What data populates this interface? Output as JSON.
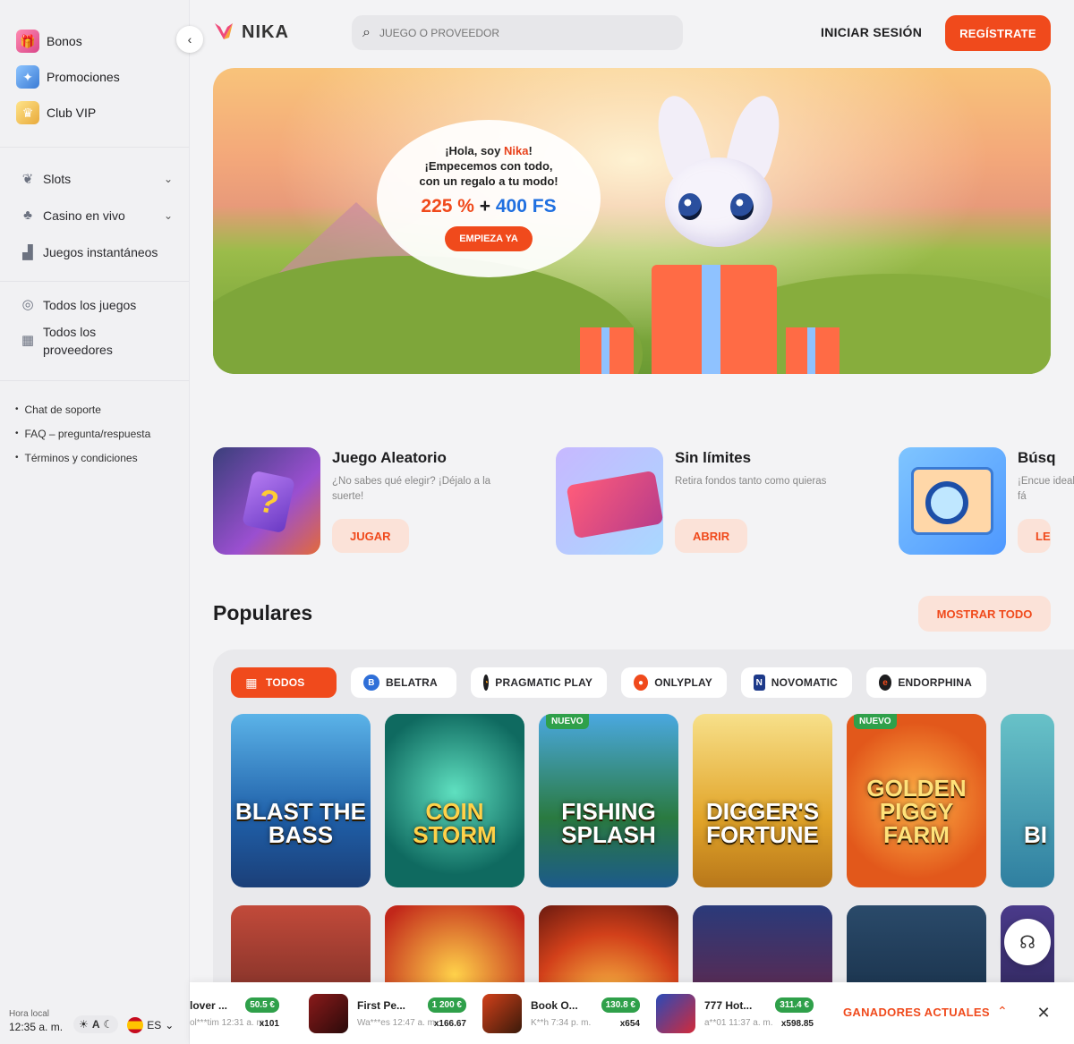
{
  "sidebar": {
    "top_items": [
      {
        "label": "Bonos",
        "icon": "gift-icon"
      },
      {
        "label": "Promociones",
        "icon": "promo-icon"
      },
      {
        "label": "Club VIP",
        "icon": "crown-icon"
      }
    ],
    "categories": [
      {
        "label": "Slots",
        "icon": "cherries-icon"
      },
      {
        "label": "Casino en vivo",
        "icon": "dealer-icon"
      },
      {
        "label": "Juegos instantáneos",
        "icon": "chart-icon"
      }
    ],
    "all_items": [
      {
        "label": "Todos los juegos",
        "icon": "compass-icon"
      },
      {
        "label": "Todos los proveedores",
        "icon": "grid-icon"
      }
    ],
    "links": [
      "Chat de soporte",
      "FAQ – pregunta/respuesta",
      "Términos y condiciones"
    ],
    "time_label": "Hora local",
    "time_value": "12:35 a. m.",
    "theme_label": "A",
    "lang": "ES"
  },
  "header": {
    "logo_text": "NIKA",
    "search_placeholder": "JUEGO O PROVEEDOR",
    "login": "INICIAR SESIÓN",
    "register": "REGÍSTRATE"
  },
  "hero": {
    "line1_pre": "¡Hola, soy ",
    "line1_name": "Nika",
    "line1_post": "!",
    "line2": "¡Empecemos con todo,",
    "line3": "con un regalo a tu modo!",
    "offer_a": "225 %",
    "offer_plus": " + ",
    "offer_b": "400 FS",
    "cta": "EMPIEZA YA"
  },
  "features": [
    {
      "title": "Juego Aleatorio",
      "desc": "¿No sabes qué elegir? ¡Déjalo a la suerte!",
      "button": "JUGAR"
    },
    {
      "title": "Sin límites",
      "desc": "Retira fondos tanto como quieras",
      "button": "ABRIR"
    },
    {
      "title": "Búsq",
      "desc": "¡Encue ideal fá",
      "button": "LE"
    }
  ],
  "popular": {
    "title": "Populares",
    "show_all": "MOSTRAR TODO",
    "providers": [
      "TODOS",
      "BELATRA",
      "PRAGMATIC PLAY",
      "ONLYPLAY",
      "NOVOMATIC",
      "ENDORPHINA"
    ],
    "row1": [
      {
        "name": "BLAST THE BASS",
        "badge": ""
      },
      {
        "name": "COIN STORM",
        "badge": ""
      },
      {
        "name": "FISHING SPLASH",
        "badge": "NUEVO"
      },
      {
        "name": "DIGGER'S FORTUNE",
        "badge": ""
      },
      {
        "name": "GOLDEN PIGGY FARM",
        "badge": "NUEVO"
      },
      {
        "name": "BI",
        "badge": ""
      }
    ],
    "row2_count": 6
  },
  "winners": {
    "label": "GANADORES ACTUALES",
    "items": [
      {
        "game": "lover ...",
        "user": "ol***tim 12:31 a. m.",
        "amount": "50.5 €",
        "mult": "x101"
      },
      {
        "game": "First Pe...",
        "user": "Wa***es 12:47 a. m.",
        "amount": "1 200 €",
        "mult": "x166.67"
      },
      {
        "game": "Book O...",
        "user": "K**h 7:34 p. m.",
        "amount": "130.8 €",
        "mult": "x654"
      },
      {
        "game": "777 Hot...",
        "user": "a**01 11:37 a. m.",
        "amount": "311.4 €",
        "mult": "x598.85"
      }
    ]
  },
  "colors": {
    "accent": "#f04a1c",
    "win_badge": "#2fa04a",
    "offer_blue": "#1f6fe0"
  }
}
